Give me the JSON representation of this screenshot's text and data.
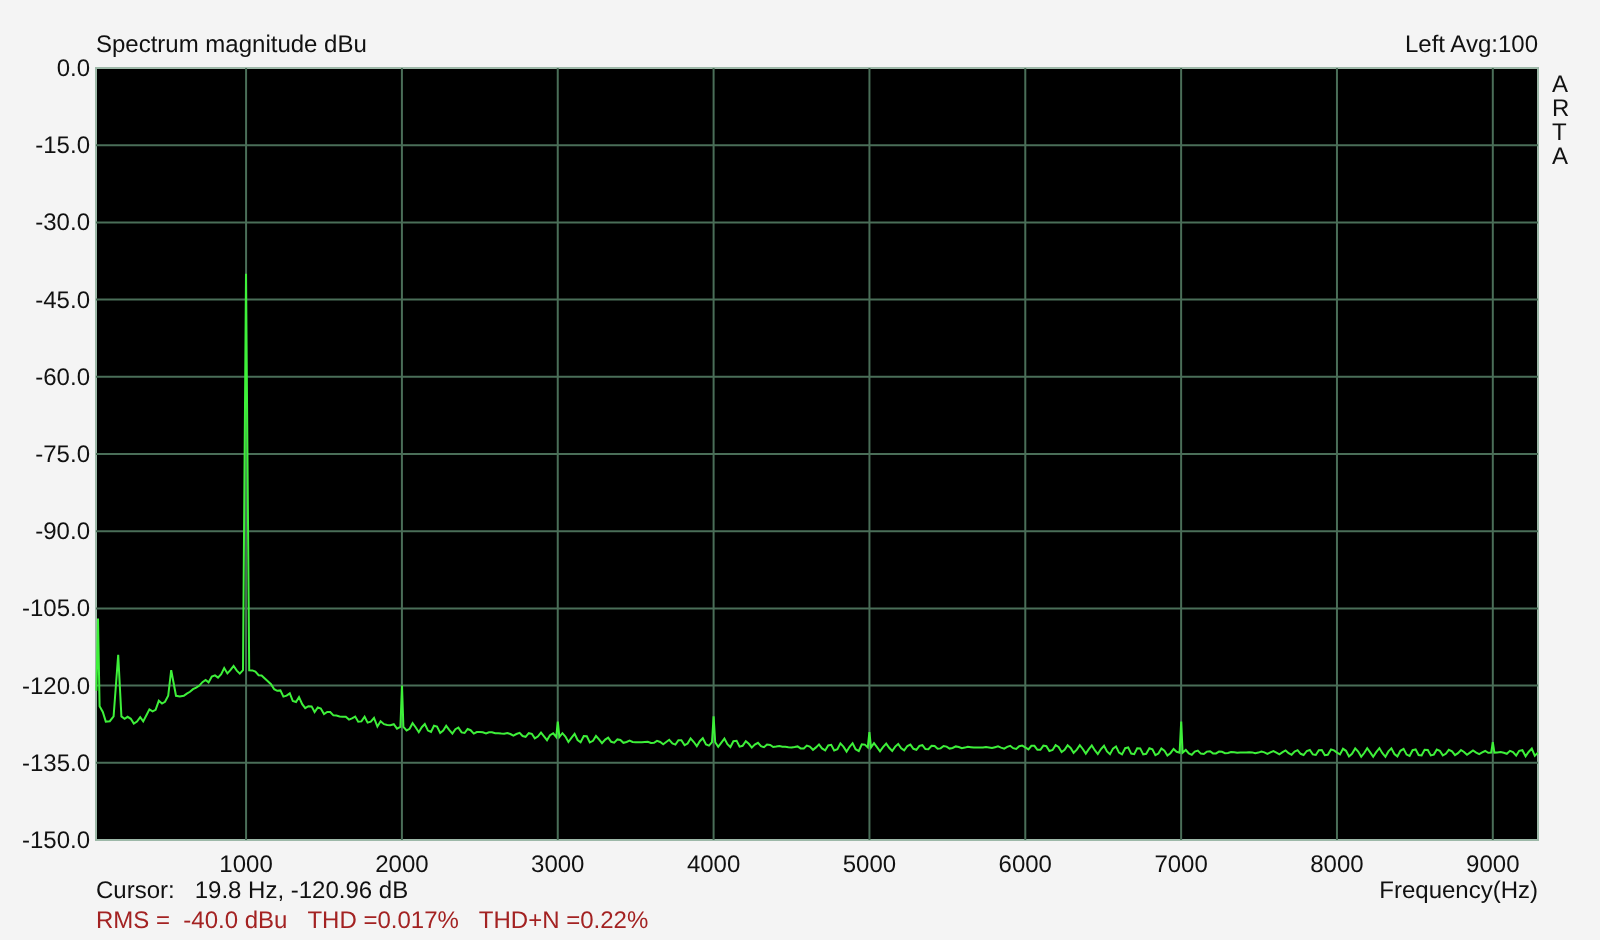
{
  "header": {
    "average": "Avg:100"
  },
  "brand": "ARTA",
  "chart_data": {
    "type": "line",
    "title": "Spectrum magnitude dBu",
    "xlabel": "Frequency(Hz)",
    "xlim": [
      37,
      9290
    ],
    "ylim": [
      -150,
      0
    ],
    "grid": true,
    "xticks": [
      1000,
      2000,
      3000,
      4000,
      5000,
      6000,
      7000,
      8000,
      9000
    ],
    "yticks": [
      {
        "value": 0,
        "label": "0.0"
      },
      {
        "value": -15,
        "label": "-15.0"
      },
      {
        "value": -30,
        "label": "-30.0"
      },
      {
        "value": -45,
        "label": "-45.0"
      },
      {
        "value": -60,
        "label": "-60.0"
      },
      {
        "value": -75,
        "label": "-75.0"
      },
      {
        "value": -90,
        "label": "-90.0"
      },
      {
        "value": -105,
        "label": "-105.0"
      },
      {
        "value": -120,
        "label": "-120.0"
      },
      {
        "value": -135,
        "label": "-135.0"
      },
      {
        "value": -150,
        "label": "-150.0"
      }
    ],
    "x": [
      40,
      50,
      60,
      100,
      150,
      180,
      200,
      300,
      400,
      500,
      520,
      550,
      600,
      700,
      800,
      900,
      980,
      1000,
      1020,
      1100,
      1200,
      1400,
      1600,
      1800,
      1990,
      2000,
      2010,
      2500,
      2990,
      3000,
      3010,
      3500,
      3990,
      4000,
      4010,
      4500,
      4990,
      5000,
      5010,
      6000,
      6990,
      7000,
      7010,
      8000,
      8990,
      9000,
      9010,
      9290
    ],
    "series": [
      {
        "name": "Left",
        "color": "#3ef03a",
        "values": [
          -121,
          -107,
          -124,
          -127,
          -126,
          -114,
          -126,
          -127,
          -125,
          -122,
          -117,
          -122,
          -122,
          -120,
          -118,
          -117,
          -117,
          -40,
          -117,
          -118,
          -121,
          -124,
          -126,
          -127,
          -128,
          -120,
          -128,
          -129,
          -130,
          -127,
          -130,
          -131,
          -131,
          -126,
          -131,
          -132,
          -132,
          -129,
          -132,
          -132,
          -133,
          -127,
          -133,
          -133,
          -133,
          -131,
          -133,
          -133
        ]
      }
    ]
  },
  "cursor": {
    "label": "Cursor:",
    "reading": "19.8 Hz, -120.96 dB"
  },
  "measurements": [
    "RMS =  -40.0 dBu",
    "THD =0.017%",
    "THD+N =0.22%"
  ]
}
